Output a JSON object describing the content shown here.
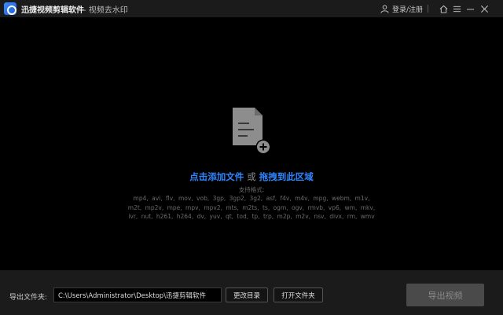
{
  "titlebar": {
    "app_name": "迅捷视频剪辑软件",
    "subtitle": "- 视频去水印",
    "login_label": "登录/注册",
    "icons": [
      "app-logo",
      "user-icon",
      "home-icon",
      "menu-icon",
      "minimize-icon",
      "close-icon"
    ]
  },
  "dropzone": {
    "add_file": "点击添加文件",
    "or": "或",
    "drag_here": "拖拽到此区域",
    "formats_title": "支持格式:",
    "formats_lines": [
      "mp4, avi, flv, mov, vob, 3gp, 3gp2, 3g2, asf, f4v, m4v, mpg, webm, m1v,",
      "m2t, mp2v, mpe, mpv, mpv2, mts, m2ts, ts, ogm, ogv, rmvb, vp6, wm, mkv,",
      "ivr, nut, h261, h264, dv, yuv, qt, tod, tp, trp, m2p, m2v, nsv, divx, rm, wmv"
    ]
  },
  "bottombar": {
    "output_label": "导出文件夹:",
    "output_path": "C:\\Users\\Administrator\\Desktop\\迅捷剪辑软件",
    "change_dir": "更改目录",
    "open_folder": "打开文件夹",
    "export_video": "导出视频"
  },
  "colors": {
    "accent": "#2f86ff",
    "background": "#000000",
    "bar": "#1b1b1b"
  }
}
